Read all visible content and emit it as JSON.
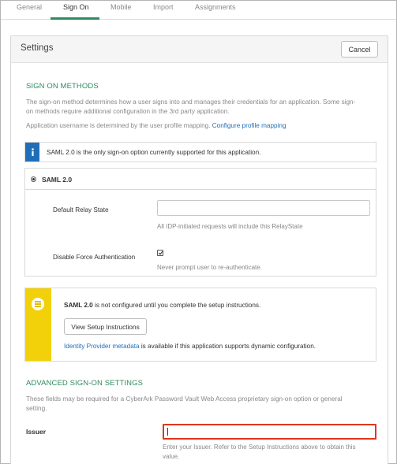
{
  "tabs": [
    "General",
    "Sign On",
    "Mobile",
    "Import",
    "Assignments"
  ],
  "settings": {
    "title": "Settings",
    "cancel_label": "Cancel"
  },
  "sign_on_methods": {
    "heading": "SIGN ON METHODS",
    "desc_line1": "The sign-on method determines how a user signs into and manages their credentials for an application. Some sign-",
    "desc_line2": "on methods require additional configuration in the 3rd party application.",
    "username_text": "Application username is determined by the user profile mapping.",
    "profile_link": "Configure profile mapping",
    "info_text": "SAML 2.0 is the only sign-on option currently supported for this application.",
    "method_label": "SAML 2.0",
    "relay_state_label": "Default Relay State",
    "relay_state_value": "",
    "relay_state_hint": "All IDP-initiated requests will include this RelayState",
    "force_auth_label": "Disable Force Authentication",
    "force_auth_checked": true,
    "force_auth_hint": "Never prompt user to re-authenticate."
  },
  "setup_notice": {
    "bold": "SAML 2.0",
    "text": " is not configured until you complete the setup instructions.",
    "button_label": "View Setup Instructions",
    "metadata_link": "Identity Provider metadata",
    "metadata_text": " is available if this application supports dynamic configuration."
  },
  "advanced": {
    "heading": "ADVANCED SIGN-ON SETTINGS",
    "desc_line1": "These fields may be required for a CyberArk Password Vault Web Access proprietary sign-on option or general",
    "desc_line2": "setting.",
    "issuer_label": "Issuer",
    "issuer_value": "",
    "issuer_hint_line1": "Enter your Issuer. Refer to the Setup Instructions above to obtain this",
    "issuer_hint_line2": "value."
  },
  "colors": {
    "accent_green": "#2d8b5e",
    "link_blue": "#1f6fb8",
    "warning_yellow": "#f2d10b",
    "highlight_red": "#e0351e"
  }
}
